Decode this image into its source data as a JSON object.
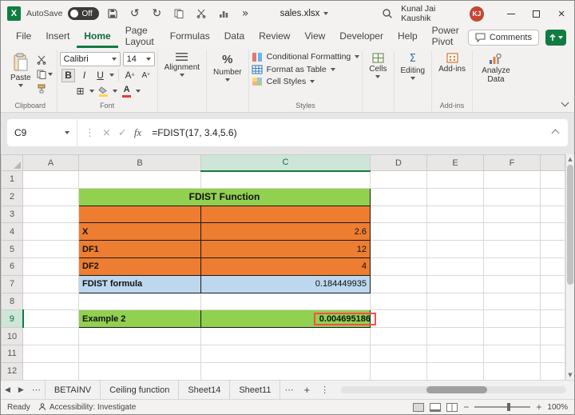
{
  "titlebar": {
    "autosave_label": "AutoSave",
    "autosave_state": "Off",
    "filename": "sales.xlsx",
    "user_name": "Kunal Jai Kaushik",
    "user_initials": "KJ"
  },
  "menubar": {
    "items": [
      "File",
      "Insert",
      "Home",
      "Page Layout",
      "Formulas",
      "Data",
      "Review",
      "View",
      "Developer",
      "Help",
      "Power Pivot"
    ],
    "active_item": "Home",
    "comments_label": "Comments"
  },
  "ribbon": {
    "paste_label": "Paste",
    "clipboard_group_label": "Clipboard",
    "font_name": "Calibri",
    "font_size": "14",
    "bold_label": "B",
    "italic_label": "I",
    "underline_label": "U",
    "font_group_label": "Font",
    "alignment_label": "Alignment",
    "number_label": "Number",
    "conditional_formatting_label": "Conditional Formatting",
    "format_as_table_label": "Format as Table",
    "cell_styles_label": "Cell Styles",
    "styles_group_label": "Styles",
    "cells_label": "Cells",
    "editing_label": "Editing",
    "addins_label": "Add-ins",
    "analyze_data_label": "Analyze Data",
    "addins_group_label": "Add-ins"
  },
  "formula_bar": {
    "name_box": "C9",
    "fx_label": "fx",
    "formula": "=FDIST(17, 3.4,5.6)"
  },
  "grid": {
    "column_headers": [
      "A",
      "B",
      "C",
      "D",
      "E",
      "F"
    ],
    "row_headers": [
      "1",
      "2",
      "3",
      "4",
      "5",
      "6",
      "7",
      "8",
      "9",
      "10",
      "11",
      "12"
    ],
    "cells": {
      "title": "FDIST Function",
      "x_label": "X",
      "x_value": "2.6",
      "df1_label": "DF1",
      "df1_value": "12",
      "df2_label": "DF2",
      "df2_value": "4",
      "fdist_label": "FDIST formula",
      "fdist_value": "0.184449935",
      "example_label": "Example 2",
      "example_value": "0.004695186"
    }
  },
  "sheet_tabs": {
    "tabs": [
      "BETAINV",
      "Ceiling function",
      "Sheet14",
      "Sheet11"
    ]
  },
  "status_bar": {
    "ready_label": "Ready",
    "accessibility_label": "Accessibility: Investigate",
    "zoom_level": "100%"
  },
  "colors": {
    "green_fill": "#92D050",
    "orange_fill": "#ED7D31",
    "blue_fill": "#BDD7EE",
    "excel_green": "#107C41",
    "annotation_red": "#FF4D4D",
    "avatar_orange": "#C74634"
  }
}
